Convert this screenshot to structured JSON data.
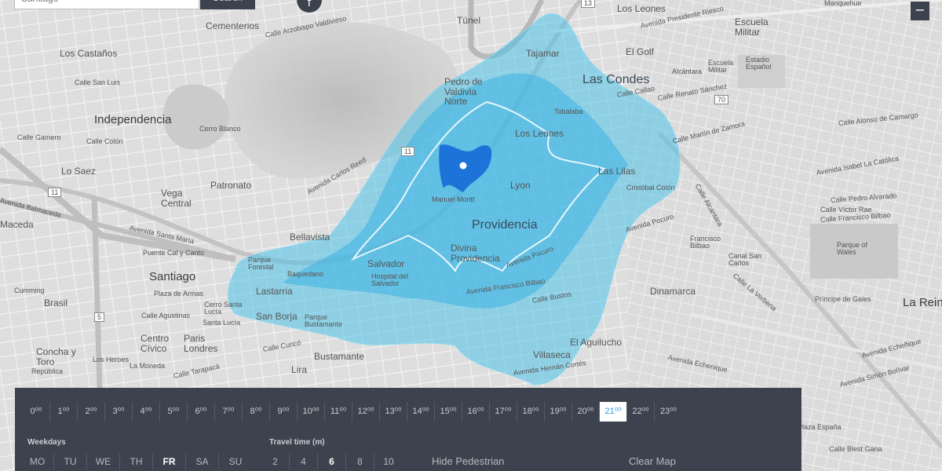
{
  "search": {
    "value": "Santiago",
    "button_label": "Search",
    "locate_glyph": "f",
    "zoom_out_glyph": "−"
  },
  "map": {
    "labels": [
      {
        "id": "los-leones-n",
        "text": "Los Leones",
        "cls": "mid"
      },
      {
        "id": "escuela-militar",
        "text": "Escuela\nMilitar",
        "cls": "mid"
      },
      {
        "id": "cementerios",
        "text": "Cementerios",
        "cls": "mid"
      },
      {
        "id": "los-castanos",
        "text": "Los Castaños",
        "cls": "mid"
      },
      {
        "id": "tajamar",
        "text": "Tajamar",
        "cls": "mid"
      },
      {
        "id": "el-golf",
        "text": "El Golf",
        "cls": "mid"
      },
      {
        "id": "las-condes",
        "text": "Las Condes",
        "cls": "xl"
      },
      {
        "id": "pedro-valdivia",
        "text": "Pedro de\nValdivia\nNorte",
        "cls": "mid"
      },
      {
        "id": "independencia",
        "text": "Independencia",
        "cls": "big"
      },
      {
        "id": "cerro-blanco",
        "text": "Cerro Blanco",
        "cls": "sm"
      },
      {
        "id": "los-leones-c",
        "text": "Los Leones",
        "cls": "mid"
      },
      {
        "id": "lo-saez",
        "text": "Lo Saez",
        "cls": "mid"
      },
      {
        "id": "patronato",
        "text": "Patronato",
        "cls": "mid"
      },
      {
        "id": "vega-central",
        "text": "Vega\nCentral",
        "cls": "mid"
      },
      {
        "id": "lyon",
        "text": "Lyon",
        "cls": "mid"
      },
      {
        "id": "las-lilas",
        "text": "Las Lilas",
        "cls": "mid"
      },
      {
        "id": "cristobal-colon",
        "text": "Cristóbal Colón",
        "cls": "sm"
      },
      {
        "id": "manuel-montt",
        "text": "Manuel Montt",
        "cls": "sm"
      },
      {
        "id": "providencia",
        "text": "Providencia",
        "cls": "xl"
      },
      {
        "id": "bellavista",
        "text": "Bellavista",
        "cls": "mid"
      },
      {
        "id": "parque-forestal",
        "text": "Parque\nForestal",
        "cls": "sm"
      },
      {
        "id": "salvador",
        "text": "Salvador",
        "cls": "mid"
      },
      {
        "id": "hospital-salvador",
        "text": "Hospital del\nSalvador",
        "cls": "sm"
      },
      {
        "id": "divina-providencia",
        "text": "Divina\nProvidencia",
        "cls": "mid"
      },
      {
        "id": "santiago",
        "text": "Santiago",
        "cls": "big"
      },
      {
        "id": "baquedano",
        "text": "Baquedano",
        "cls": "sm"
      },
      {
        "id": "lastarria",
        "text": "Lastarria",
        "cls": "mid"
      },
      {
        "id": "plaza-armas",
        "text": "Plaza de Armas",
        "cls": "sm"
      },
      {
        "id": "brasil",
        "text": "Brasil",
        "cls": "mid"
      },
      {
        "id": "cumming",
        "text": "Cumming",
        "cls": "sm"
      },
      {
        "id": "san-borja",
        "text": "San Borja",
        "cls": "mid"
      },
      {
        "id": "parque-bustamante",
        "text": "Parque\nBustamante",
        "cls": "sm"
      },
      {
        "id": "santa-lucia",
        "text": "Santa Lucía",
        "cls": "sm"
      },
      {
        "id": "cerro-santa-lucia",
        "text": "Cerro Santa\nLucía",
        "cls": "sm"
      },
      {
        "id": "centro-civico",
        "text": "Centro\nCívico",
        "cls": "mid"
      },
      {
        "id": "paris-londres",
        "text": "Paris\nLondres",
        "cls": "mid"
      },
      {
        "id": "concha-toro",
        "text": "Concha y\nToro",
        "cls": "mid"
      },
      {
        "id": "la-moneda",
        "text": "La Moneda",
        "cls": "sm"
      },
      {
        "id": "republica",
        "text": "República",
        "cls": "sm"
      },
      {
        "id": "bustamante",
        "text": "Bustamante",
        "cls": "mid"
      },
      {
        "id": "lira",
        "text": "Lira",
        "cls": "mid"
      },
      {
        "id": "villaseca",
        "text": "Villaseca",
        "cls": "mid"
      },
      {
        "id": "el-aguilucho",
        "text": "El Aguilucho",
        "cls": "mid"
      },
      {
        "id": "dinamarca",
        "text": "Dinamarca",
        "cls": "mid"
      },
      {
        "id": "francisco-bilbao",
        "text": "Francisco\nBilbao",
        "cls": "sm"
      },
      {
        "id": "canal-san-carlos",
        "text": "Canal San\nCarlos",
        "cls": "sm"
      },
      {
        "id": "parque-principe",
        "text": "Parque of\nWales",
        "cls": "sm"
      },
      {
        "id": "principe-gales",
        "text": "Príncipe de Gales",
        "cls": "sm"
      },
      {
        "id": "la-reina",
        "text": "La Reina",
        "cls": "big"
      },
      {
        "id": "estadio-espanol",
        "text": "Estadio\nEspañol",
        "cls": "sm"
      },
      {
        "id": "alcantara",
        "text": "Alcántara",
        "cls": "sm"
      },
      {
        "id": "escuela-militar-st",
        "text": "Escuela\nMilitar",
        "cls": "sm"
      },
      {
        "id": "tobalaba",
        "text": "Tobalaba",
        "cls": "sm"
      },
      {
        "id": "manquehue",
        "text": "Manquehue",
        "cls": "sm"
      },
      {
        "id": "maceda",
        "text": "Maceda",
        "cls": "mid"
      },
      {
        "id": "plaza-espana",
        "text": "Plaza España",
        "cls": "sm"
      },
      {
        "id": "tunel",
        "text": "Túnel",
        "cls": "mid"
      }
    ],
    "streets": [
      {
        "id": "st-presidente-riesco",
        "text": "Avenida Presidente Riesco"
      },
      {
        "id": "st-arzobispo",
        "text": "Calle Arzobispo Valdivieso"
      },
      {
        "id": "st-san-luis",
        "text": "Calle San Luis"
      },
      {
        "id": "st-gamero",
        "text": "Calle Gamero"
      },
      {
        "id": "st-colon",
        "text": "Calle Colón"
      },
      {
        "id": "st-alonso",
        "text": "Calle Alonso de Camargo"
      },
      {
        "id": "st-zamora",
        "text": "Calle Martín de Zamora"
      },
      {
        "id": "st-isabel",
        "text": "Avenida Isabel La Católica"
      },
      {
        "id": "st-carlos-reed",
        "text": "Avenida Carlos Reed"
      },
      {
        "id": "st-balmaceda",
        "text": "Avenida Balmaceda"
      },
      {
        "id": "st-santa-maria",
        "text": "Avenida Santa María"
      },
      {
        "id": "st-pocuro",
        "text": "Avenida Pocuro"
      },
      {
        "id": "st-pocuro2",
        "text": "Avenida Pocuro"
      },
      {
        "id": "st-bilbao",
        "text": "Avenida Francisco Bilbao"
      },
      {
        "id": "st-bustos",
        "text": "Calle Bustos"
      },
      {
        "id": "st-agustinas",
        "text": "Calle Agustinas"
      },
      {
        "id": "st-curico",
        "text": "Calle Curicó"
      },
      {
        "id": "st-heroes",
        "text": "Los Heroes"
      },
      {
        "id": "st-tarapaca",
        "text": "Calle Tarapacá"
      },
      {
        "id": "st-hernan-cortes",
        "text": "Avenida Hernán Cortés"
      },
      {
        "id": "st-echenique",
        "text": "Avenida Echenique"
      },
      {
        "id": "st-echenique2",
        "text": "Avenida Echeñique"
      },
      {
        "id": "st-simon-bolivar",
        "text": "Avenida Simón Bolívar"
      },
      {
        "id": "st-blest-gana",
        "text": "Calle Blest Gana"
      },
      {
        "id": "st-bilbao-east",
        "text": "Calle Francisco Bilbao"
      },
      {
        "id": "st-victor-rae",
        "text": "Calle Víctor Rae"
      },
      {
        "id": "st-alvarado",
        "text": "Calle Pedro Alvarado"
      },
      {
        "id": "st-callao",
        "text": "Calle Callao"
      },
      {
        "id": "st-renato",
        "text": "Calle Renato Sánchez"
      },
      {
        "id": "st-la-verbena",
        "text": "Calle La Verbena"
      },
      {
        "id": "st-alcantara",
        "text": "Calle Alcántara"
      },
      {
        "id": "st-bandera",
        "text": "Puente Cal y Canto"
      }
    ],
    "shields": [
      "11",
      "11",
      "13",
      "70",
      "5"
    ]
  },
  "colors": {
    "isochrone_outer": "#4fc3e8",
    "isochrone_mid": "#3ab2e4",
    "isochrone_core": "#1e73d8",
    "panel_bg": "#3d434e",
    "active_hour": "#2f9bd7"
  },
  "timeline": {
    "hours": [
      "0⁰⁰",
      "1⁰⁰",
      "2⁰⁰",
      "3⁰⁰",
      "4⁰⁰",
      "5⁰⁰",
      "6⁰⁰",
      "7⁰⁰",
      "8⁰⁰",
      "9⁰⁰",
      "10⁰⁰",
      "11⁰⁰",
      "12⁰⁰",
      "13⁰⁰",
      "14⁰⁰",
      "15⁰⁰",
      "16⁰⁰",
      "17⁰⁰",
      "18⁰⁰",
      "19⁰⁰",
      "20⁰⁰",
      "21⁰⁰",
      "22⁰⁰",
      "23⁰⁰"
    ],
    "active_hour": "21⁰⁰",
    "weekdays_label": "Weekdays",
    "weekdays": [
      "MO",
      "TU",
      "WE",
      "TH",
      "FR",
      "SA",
      "SU"
    ],
    "active_weekday": "FR",
    "travel_label": "Travel time (m)",
    "travel_times": [
      "2",
      "4",
      "6",
      "8",
      "10"
    ],
    "active_travel": "6",
    "hide_pedestrian": "Hide Pedestrian",
    "clear_map": "Clear Map"
  }
}
